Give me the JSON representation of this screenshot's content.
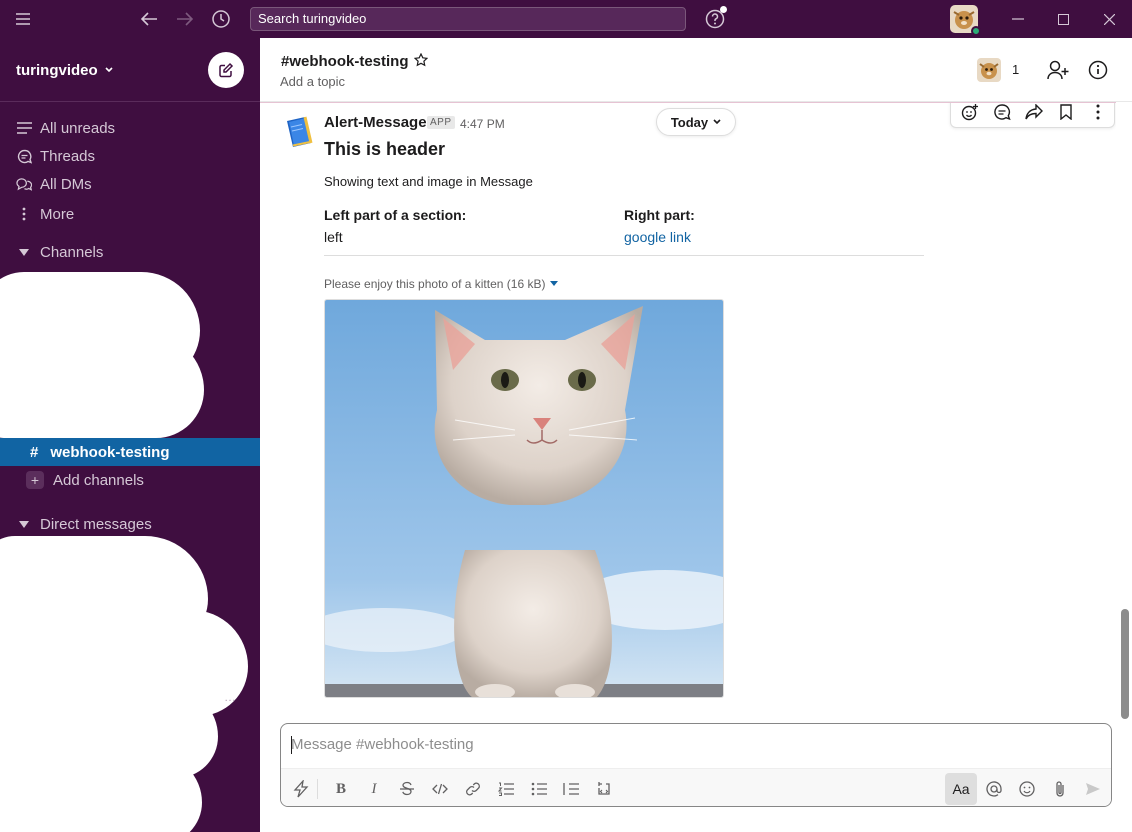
{
  "app": {
    "search_placeholder": "Search turingvideo",
    "workspace": "turingvideo"
  },
  "sidebar": {
    "nav": [
      {
        "label": "All unreads",
        "icon": "all-unreads-icon"
      },
      {
        "label": "Threads",
        "icon": "threads-icon"
      },
      {
        "label": "All DMs",
        "icon": "dms-icon"
      },
      {
        "label": "More",
        "icon": "more-vertical-icon"
      }
    ],
    "channels_heading": "Channels",
    "active_channel": "webhook-testing",
    "add_channels": "Add channels",
    "dm_heading": "Direct messages"
  },
  "channel": {
    "title": "#webhook-testing",
    "topic": "Add a topic",
    "member_count": "1"
  },
  "message": {
    "sender": "Alert-Message",
    "badge": "APP",
    "time": "4:47 PM",
    "date_divider": "Today",
    "header": "This is header",
    "text": "Showing text and image in Message",
    "fields": [
      {
        "label": "Left part of a section:",
        "value": "left"
      },
      {
        "label": "Right part:",
        "value": "google link"
      }
    ],
    "image_caption": "Please enjoy this photo of a kitten (16 kB)"
  },
  "composer": {
    "placeholder": "Message #webhook-testing",
    "format_toggle": "Aa"
  },
  "colors": {
    "sidebar_bg": "#3f0e40",
    "active_channel": "#1164a3",
    "link": "#1264a3",
    "presence": "#2bac76"
  }
}
